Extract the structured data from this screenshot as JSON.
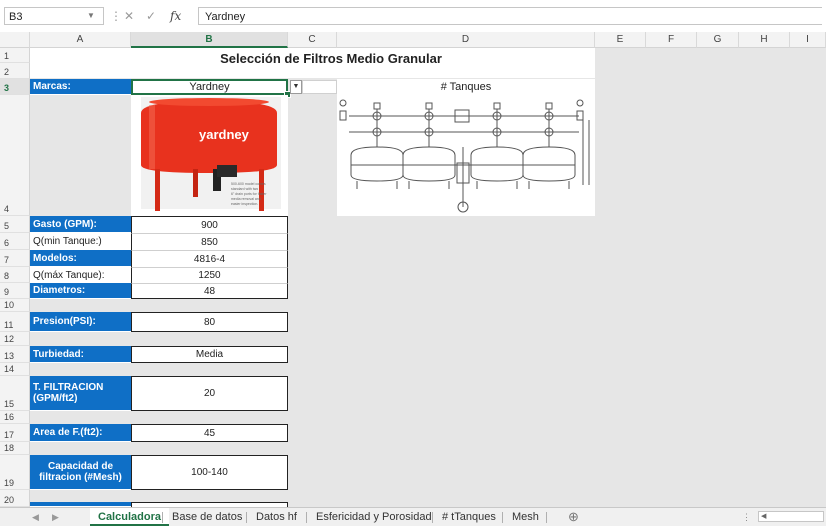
{
  "formula_bar": {
    "name_box": "B3",
    "formula": "Yardney",
    "cancel_icon": "✕",
    "enter_icon": "✓",
    "fx_label": "fx"
  },
  "columns": [
    "A",
    "B",
    "C",
    "D",
    "E",
    "F",
    "G",
    "H",
    "I"
  ],
  "selected_column": "B",
  "rows": [
    "1",
    "2",
    "3",
    "4",
    "5",
    "6",
    "7",
    "8",
    "9",
    "10",
    "11",
    "12",
    "13",
    "14",
    "15",
    "16",
    "17",
    "18",
    "19",
    "20"
  ],
  "selected_row": "3",
  "title": "Selección de Filtros Medio Granular",
  "marcas": {
    "label": "Marcas:",
    "value": "Yardney"
  },
  "tanques_header": "# Tanques",
  "tank_image": {
    "brand_text": "yardney",
    "caption": "500-600 model comes standard with two 6\" drain ports for faster media removal and easier inspection."
  },
  "fields": [
    {
      "label": "Gasto (GPM):",
      "value": "900"
    },
    {
      "label": "Q(min Tanque:)",
      "value": "850"
    },
    {
      "label": "Modelos:",
      "value": "4816-4"
    },
    {
      "label": "Q(máx Tanque):",
      "value": "1250"
    },
    {
      "label": "Diametros:",
      "value": "48"
    }
  ],
  "presion": {
    "label": "Presion(PSI):",
    "value": "80"
  },
  "turbiedad": {
    "label": "Turbiedad:",
    "value": "Media"
  },
  "filtracion": {
    "label_line1": "T. FILTRACION",
    "label_line2": "(GPM/ft2)",
    "value": "20"
  },
  "area": {
    "label": "Area de F.(ft2):",
    "value": "45"
  },
  "capacidad": {
    "label_line1": "Capacidad de",
    "label_line2": "filtracion (#Mesh)",
    "value": "100-140"
  },
  "tabs": [
    "Calculadora",
    "Base de datos",
    "Datos hf",
    "Esfericidad y Porosidad",
    "# tTanques",
    "Mesh"
  ],
  "active_tab": "Calculadora",
  "add_sheet_icon": "⊕",
  "colors": {
    "label_bg": "#0f6fc6",
    "selection": "#217346",
    "tank_red": "#e8321e"
  }
}
